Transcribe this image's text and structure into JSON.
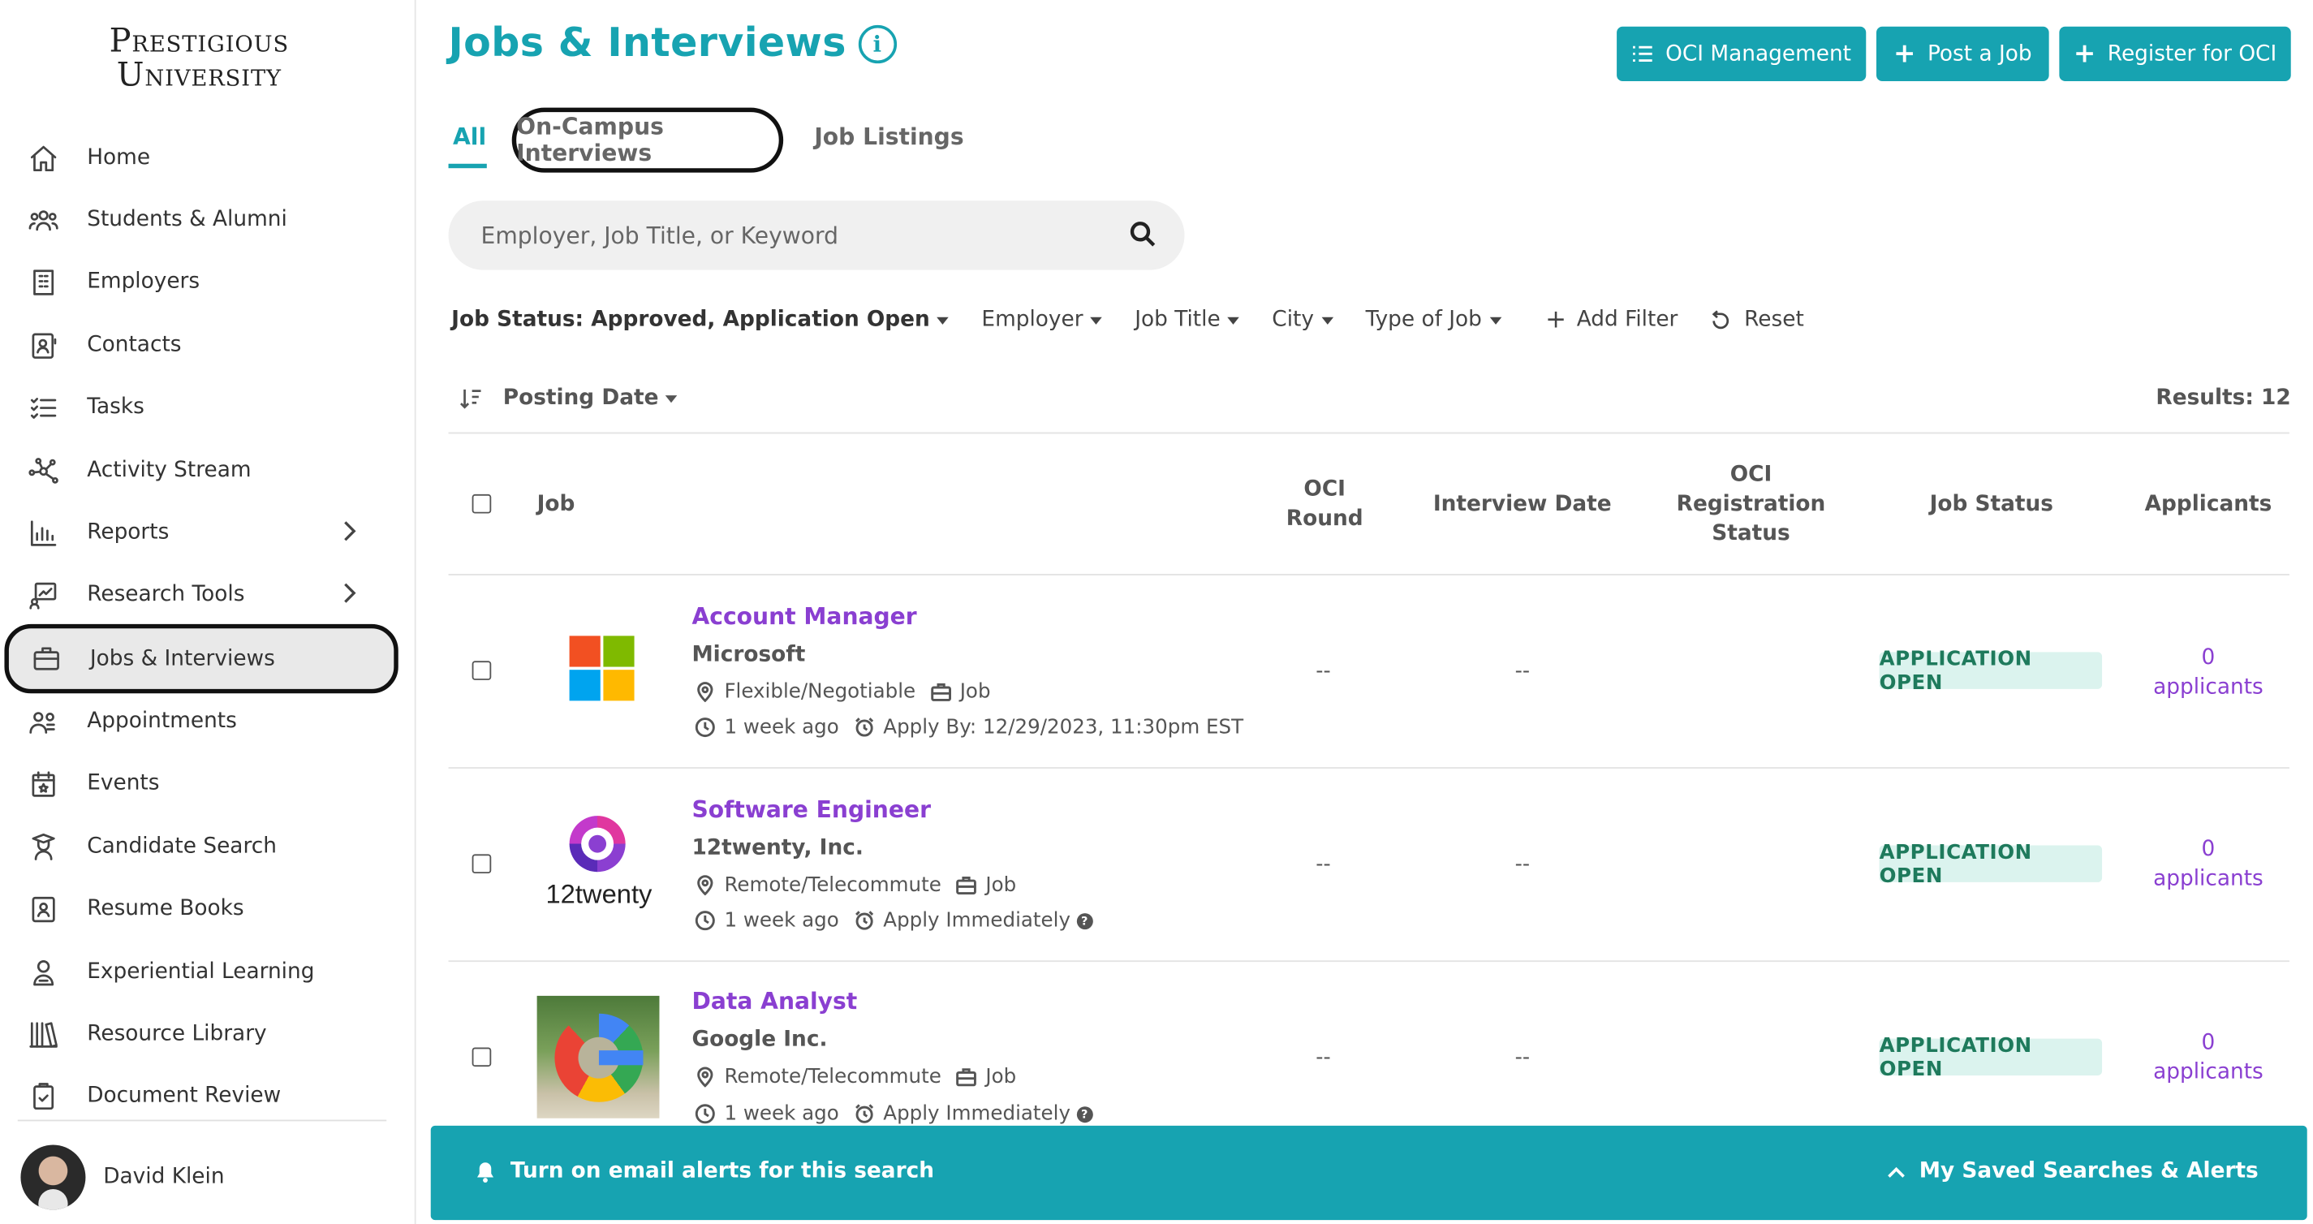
{
  "brand": {
    "line1": "Prestigious",
    "line2": "University"
  },
  "sidebar": {
    "items": [
      {
        "label": "Home"
      },
      {
        "label": "Students & Alumni"
      },
      {
        "label": "Employers"
      },
      {
        "label": "Contacts"
      },
      {
        "label": "Tasks"
      },
      {
        "label": "Activity Stream"
      },
      {
        "label": "Reports"
      },
      {
        "label": "Research Tools"
      },
      {
        "label": "Jobs & Interviews"
      },
      {
        "label": "Appointments"
      },
      {
        "label": "Events"
      },
      {
        "label": "Candidate Search"
      },
      {
        "label": "Resume Books"
      },
      {
        "label": "Experiential Learning"
      },
      {
        "label": "Resource Library"
      },
      {
        "label": "Document Review"
      }
    ],
    "active": "Jobs & Interviews"
  },
  "user": {
    "name": "David Klein"
  },
  "header": {
    "title": "Jobs & Interviews",
    "info": "i",
    "buttons": {
      "oci": "OCI Management",
      "post": "Post a Job",
      "register": "Register for OCI"
    }
  },
  "tabs": {
    "all": "All",
    "oci": "On-Campus Interviews",
    "listings": "Job Listings"
  },
  "search": {
    "placeholder": "Employer, Job Title, or Keyword"
  },
  "filters": {
    "status": "Job Status: Approved, Application Open",
    "employer": "Employer",
    "title": "Job Title",
    "city": "City",
    "type": "Type of Job",
    "add": "Add Filter",
    "reset": "Reset"
  },
  "sort": {
    "label": "Posting Date"
  },
  "results": "Results: 12",
  "table": {
    "headers": {
      "job": "Job",
      "oci_round": "OCI Round",
      "interview_date": "Interview Date",
      "oci_reg": "OCI Registration Status",
      "status": "Job Status",
      "applicants": "Applicants"
    },
    "rows": [
      {
        "title": "Account Manager",
        "company": "Microsoft",
        "location": "Flexible/Negotiable",
        "type": "Job",
        "posted": "1 week ago",
        "apply": "Apply By: 12/29/2023, 11:30pm EST",
        "oci_round": "--",
        "interview_date": "--",
        "status": "APPLICATION OPEN",
        "applicants_count": "0",
        "applicants_label": "applicants"
      },
      {
        "title": "Software Engineer",
        "company": "12twenty, Inc.",
        "logo_text": "12twenty",
        "location": "Remote/Telecommute",
        "type": "Job",
        "posted": "1 week ago",
        "apply": "Apply Immediately",
        "oci_round": "--",
        "interview_date": "--",
        "status": "APPLICATION OPEN",
        "applicants_count": "0",
        "applicants_label": "applicants"
      },
      {
        "title": "Data Analyst",
        "company": "Google Inc.",
        "location": "Remote/Telecommute",
        "type": "Job",
        "posted": "1 week ago",
        "apply": "Apply Immediately",
        "oci_round": "--",
        "interview_date": "--",
        "status": "APPLICATION OPEN",
        "applicants_count": "0",
        "applicants_label": "applicants"
      }
    ]
  },
  "footer": {
    "alerts": "Turn on email alerts for this search",
    "saved": "My Saved Searches & Alerts"
  },
  "colors": {
    "accent": "#17a3b1",
    "link": "#8a3fd1",
    "badge_bg": "#dbf3ee",
    "badge_text": "#1e7a5c"
  }
}
